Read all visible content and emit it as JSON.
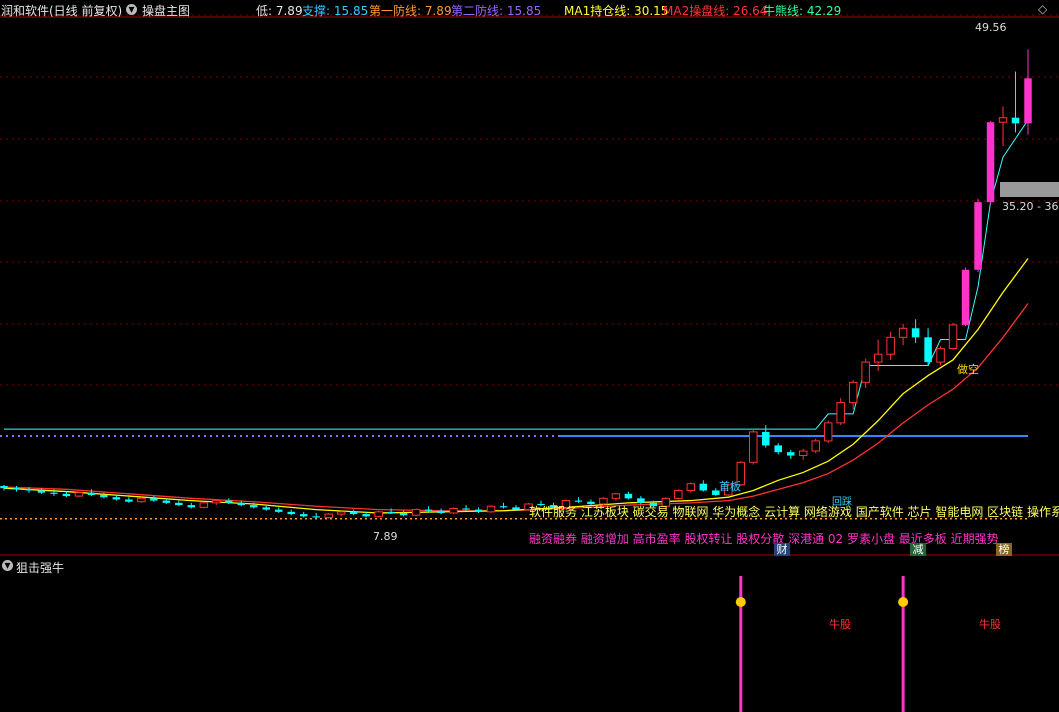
{
  "header": {
    "stock_title": "润和软件(日线 前复权)",
    "template_name": "操盘主图",
    "low_label": "低: 7.89",
    "support_label": "支撑: 15.85",
    "line1_label": "第一防线: 7.89",
    "line2_label": "第二防线: 15.85",
    "ma1_label": "MA1持仓线: 30.15",
    "ma2_label": "MA2操盘线: 26.64",
    "bull_label": "牛熊线: 42.29"
  },
  "subpanel": {
    "title": "狙击强牛"
  },
  "annotations": {
    "high_price": "49.56",
    "low_price": "7.89",
    "range_label": "35.20 - 36.",
    "first_board": "首板",
    "sell_empty": "做空",
    "small_tag": "回踩",
    "bull_stock_1": "牛股",
    "bull_stock_2": "牛股",
    "badge_cai": "财",
    "badge_jian": "减",
    "badge_bang": "榜"
  },
  "concepts_yellow": "软件服务 江苏板块 碳交易 物联网 华为概念 云计算 网络游戏 国产软件 芯片 智能电网 区块链 操作系",
  "concepts_magenta": "融资融券 融资增加 高市盈率 股权转让 股权分散 深港通 02 罗素小盘 最近多板 近期强势",
  "colors": {
    "up": "#ff3232",
    "down": "#00ffff",
    "boost": "#ff33cc",
    "ma1": "#ffff00",
    "ma2": "#ff3030",
    "support": "#33ffff",
    "guard": "#3388ff",
    "grid": "#800000"
  },
  "chart_data": {
    "type": "candlestick",
    "title": "润和软件(日线 前复权)",
    "ylim": [
      6,
      52
    ],
    "levels": {
      "low": 7.89,
      "support": 15.85,
      "first_line": 7.89,
      "second_line": 15.85,
      "ma1": 30.15,
      "ma2": 26.64,
      "bull_bear": 42.29,
      "high": 49.56,
      "range": [
        35.2,
        36.0
      ]
    },
    "candles": [
      [
        0,
        10.8,
        10.9,
        10.4,
        10.6
      ],
      [
        1,
        10.6,
        10.8,
        10.3,
        10.5
      ],
      [
        2,
        10.5,
        10.7,
        10.2,
        10.4
      ],
      [
        3,
        10.4,
        10.6,
        10.1,
        10.2
      ],
      [
        4,
        10.2,
        10.5,
        9.9,
        10.1
      ],
      [
        5,
        10.1,
        10.3,
        9.8,
        9.9
      ],
      [
        6,
        9.9,
        10.3,
        9.8,
        10.2
      ],
      [
        7,
        10.2,
        10.5,
        9.9,
        10.0
      ],
      [
        8,
        10.0,
        10.2,
        9.7,
        9.8
      ],
      [
        9,
        9.8,
        10.0,
        9.5,
        9.6
      ],
      [
        10,
        9.6,
        9.8,
        9.3,
        9.4
      ],
      [
        11,
        9.4,
        9.8,
        9.3,
        9.7
      ],
      [
        12,
        9.7,
        9.9,
        9.4,
        9.5
      ],
      [
        13,
        9.5,
        9.7,
        9.2,
        9.3
      ],
      [
        14,
        9.3,
        9.5,
        9.0,
        9.1
      ],
      [
        15,
        9.1,
        9.3,
        8.8,
        8.9
      ],
      [
        16,
        8.9,
        9.4,
        8.8,
        9.3
      ],
      [
        17,
        9.3,
        9.6,
        9.1,
        9.5
      ],
      [
        18,
        9.5,
        9.7,
        9.2,
        9.3
      ],
      [
        19,
        9.3,
        9.5,
        9.0,
        9.1
      ],
      [
        20,
        9.1,
        9.3,
        8.8,
        8.9
      ],
      [
        21,
        8.9,
        9.1,
        8.6,
        8.7
      ],
      [
        22,
        8.7,
        8.9,
        8.4,
        8.5
      ],
      [
        23,
        8.5,
        8.7,
        8.2,
        8.3
      ],
      [
        24,
        8.3,
        8.5,
        8.0,
        8.1
      ],
      [
        25,
        8.1,
        8.4,
        7.89,
        8.0
      ],
      [
        26,
        8.0,
        8.4,
        7.9,
        8.3
      ],
      [
        27,
        8.3,
        8.6,
        8.1,
        8.5
      ],
      [
        28,
        8.5,
        8.7,
        8.2,
        8.3
      ],
      [
        29,
        8.3,
        8.5,
        8.0,
        8.1
      ],
      [
        30,
        8.1,
        8.6,
        8.0,
        8.5
      ],
      [
        31,
        8.5,
        8.8,
        8.3,
        8.4
      ],
      [
        32,
        8.4,
        8.6,
        8.1,
        8.2
      ],
      [
        33,
        8.2,
        8.8,
        8.1,
        8.7
      ],
      [
        34,
        8.7,
        9.0,
        8.5,
        8.6
      ],
      [
        35,
        8.6,
        8.8,
        8.3,
        8.4
      ],
      [
        36,
        8.4,
        8.9,
        8.3,
        8.8
      ],
      [
        37,
        8.8,
        9.1,
        8.6,
        8.7
      ],
      [
        38,
        8.7,
        8.9,
        8.4,
        8.5
      ],
      [
        39,
        8.5,
        9.1,
        8.4,
        9.0
      ],
      [
        40,
        9.0,
        9.3,
        8.8,
        8.9
      ],
      [
        41,
        8.9,
        9.1,
        8.6,
        8.7
      ],
      [
        42,
        8.7,
        9.3,
        8.6,
        9.2
      ],
      [
        43,
        9.2,
        9.5,
        9.0,
        9.1
      ],
      [
        44,
        9.1,
        9.3,
        8.8,
        8.9
      ],
      [
        45,
        8.9,
        9.6,
        8.8,
        9.5
      ],
      [
        46,
        9.5,
        9.8,
        9.3,
        9.4
      ],
      [
        47,
        9.4,
        9.6,
        9.1,
        9.2
      ],
      [
        48,
        9.2,
        9.8,
        9.1,
        9.7
      ],
      [
        49,
        9.7,
        10.2,
        9.5,
        10.1
      ],
      [
        50,
        10.1,
        10.3,
        9.6,
        9.7
      ],
      [
        51,
        9.7,
        9.9,
        9.2,
        9.3
      ],
      [
        52,
        9.3,
        9.5,
        8.9,
        9.0
      ],
      [
        53,
        9.0,
        9.8,
        8.9,
        9.7
      ],
      [
        54,
        9.7,
        10.5,
        9.6,
        10.4
      ],
      [
        55,
        10.4,
        11.1,
        10.2,
        11.0
      ],
      [
        56,
        11.0,
        11.3,
        10.3,
        10.4
      ],
      [
        57,
        10.4,
        10.6,
        9.9,
        10.0
      ],
      [
        58,
        10.0,
        11.0,
        9.9,
        10.9
      ],
      [
        59,
        10.9,
        13.0,
        10.8,
        12.9
      ],
      [
        60,
        12.9,
        15.85,
        12.7,
        15.6
      ],
      [
        61,
        15.6,
        16.2,
        14.2,
        14.4
      ],
      [
        62,
        14.4,
        14.6,
        13.6,
        13.8
      ],
      [
        63,
        13.8,
        14.0,
        13.2,
        13.5
      ],
      [
        64,
        13.5,
        14.1,
        13.1,
        13.9
      ],
      [
        65,
        13.9,
        15.0,
        13.7,
        14.8
      ],
      [
        66,
        14.8,
        16.6,
        14.6,
        16.4
      ],
      [
        67,
        16.4,
        18.6,
        16.2,
        18.2
      ],
      [
        68,
        18.2,
        20.2,
        17.6,
        20.0
      ],
      [
        69,
        20.0,
        22.1,
        19.5,
        21.8
      ],
      [
        70,
        21.8,
        23.8,
        21.0,
        22.5
      ],
      [
        71,
        22.5,
        24.5,
        22.0,
        24.0
      ],
      [
        72,
        24.0,
        25.2,
        23.3,
        24.8
      ],
      [
        73,
        24.8,
        25.6,
        23.5,
        24.0
      ],
      [
        74,
        24.0,
        24.8,
        21.5,
        21.8
      ],
      [
        75,
        21.8,
        23.2,
        21.5,
        23.0
      ],
      [
        76,
        23.0,
        25.3,
        22.9,
        25.1
      ],
      [
        77,
        25.1,
        30.2,
        25.0,
        30.0
      ],
      [
        78,
        30.0,
        36.3,
        29.8,
        36.0
      ],
      [
        79,
        36.0,
        43.2,
        35.8,
        43.1
      ],
      [
        80,
        43.1,
        44.5,
        41.0,
        43.5
      ],
      [
        81,
        43.5,
        47.6,
        42.2,
        43.0
      ],
      [
        82,
        43.0,
        49.56,
        42.0,
        47.0
      ]
    ],
    "support_line": [
      [
        0,
        15.85
      ],
      [
        60,
        15.85
      ],
      [
        61,
        15.85
      ],
      [
        65,
        15.85
      ],
      [
        66,
        17.2
      ],
      [
        68,
        17.2
      ],
      [
        69,
        21.5
      ],
      [
        74,
        21.5
      ],
      [
        75,
        23.8
      ],
      [
        77,
        23.8
      ],
      [
        78,
        28.5
      ],
      [
        79,
        36.0
      ],
      [
        80,
        40.0
      ],
      [
        82,
        43.3
      ]
    ],
    "ma1": [
      [
        0,
        10.6
      ],
      [
        5,
        10.3
      ],
      [
        10,
        9.9
      ],
      [
        15,
        9.5
      ],
      [
        20,
        9.2
      ],
      [
        25,
        8.7
      ],
      [
        30,
        8.4
      ],
      [
        35,
        8.5
      ],
      [
        40,
        8.6
      ],
      [
        45,
        8.9
      ],
      [
        50,
        9.3
      ],
      [
        55,
        9.5
      ],
      [
        58,
        9.8
      ],
      [
        60,
        10.4
      ],
      [
        62,
        11.3
      ],
      [
        64,
        12.0
      ],
      [
        66,
        13.0
      ],
      [
        68,
        14.5
      ],
      [
        70,
        16.6
      ],
      [
        72,
        19.0
      ],
      [
        74,
        20.6
      ],
      [
        76,
        22.0
      ],
      [
        78,
        24.7
      ],
      [
        80,
        28.0
      ],
      [
        82,
        31.0
      ]
    ],
    "ma2": [
      [
        0,
        10.7
      ],
      [
        5,
        10.5
      ],
      [
        10,
        10.1
      ],
      [
        15,
        9.7
      ],
      [
        20,
        9.4
      ],
      [
        25,
        9.0
      ],
      [
        30,
        8.7
      ],
      [
        35,
        8.6
      ],
      [
        40,
        8.6
      ],
      [
        45,
        8.8
      ],
      [
        50,
        9.1
      ],
      [
        55,
        9.3
      ],
      [
        58,
        9.5
      ],
      [
        60,
        9.9
      ],
      [
        62,
        10.5
      ],
      [
        64,
        11.1
      ],
      [
        66,
        11.9
      ],
      [
        68,
        13.1
      ],
      [
        70,
        14.6
      ],
      [
        72,
        16.4
      ],
      [
        74,
        18.0
      ],
      [
        76,
        19.4
      ],
      [
        78,
        21.3
      ],
      [
        80,
        24.0
      ],
      [
        82,
        27.0
      ]
    ],
    "signals": [
      {
        "x": 59,
        "label": "牛股"
      },
      {
        "x": 72,
        "label": "牛股"
      }
    ]
  }
}
